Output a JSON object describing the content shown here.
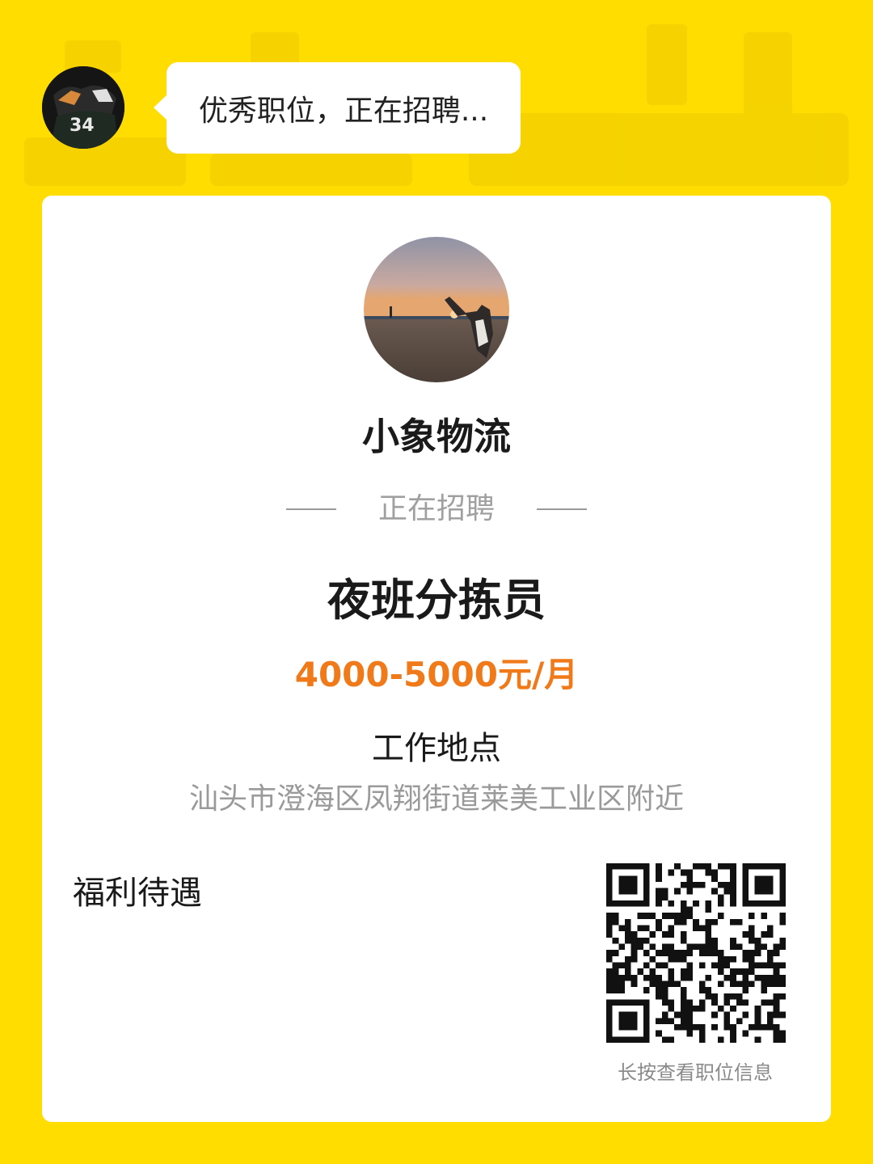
{
  "colors": {
    "background": "#FFDD00",
    "card": "#FFFFFF",
    "salary": "#F07A1A",
    "muted_text": "#9A9A9A"
  },
  "header": {
    "avatar_icon": "user-avatar-basketball-jersey",
    "bubble_text": "优秀职位，正在招聘..."
  },
  "company": {
    "logo_icon": "sunset-beach-photo",
    "name": "小象物流"
  },
  "hiring_label": "正在招聘",
  "job": {
    "title": "夜班分拣员",
    "salary": "4000-5000元/月"
  },
  "location": {
    "label": "工作地点",
    "address": "汕头市澄海区凤翔街道莱美工业区附近"
  },
  "benefits": {
    "label": "福利待遇"
  },
  "qr": {
    "icon": "qr-code",
    "hint": "长按查看职位信息"
  }
}
